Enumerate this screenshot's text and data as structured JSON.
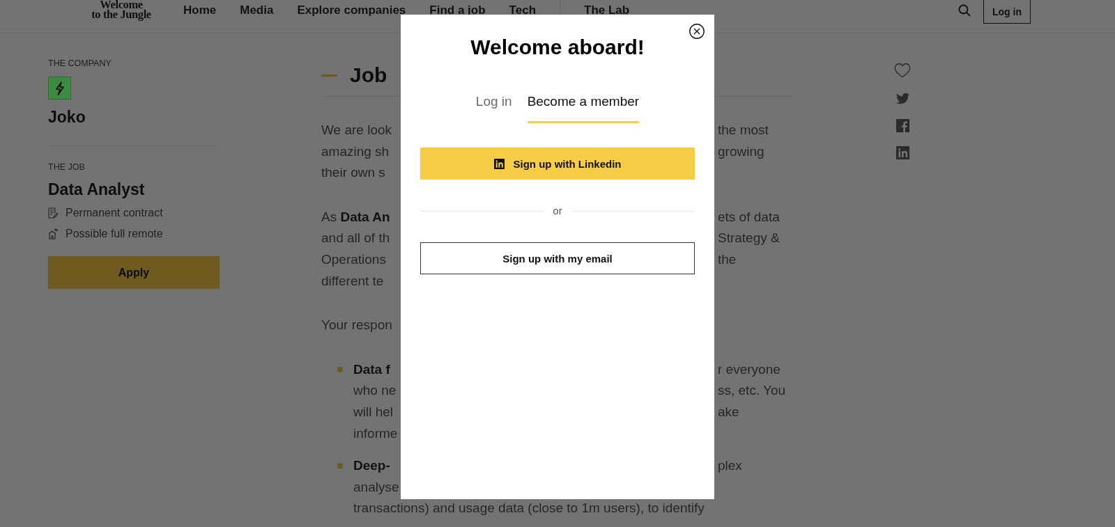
{
  "header": {
    "logo": [
      "Welcome",
      "to the Jungle"
    ],
    "nav_primary": [
      "Home",
      "Media",
      "Explore companies",
      "Find a job",
      "Tech"
    ],
    "nav_secondary": [
      "The Lab"
    ],
    "login_button": "Log in"
  },
  "sidebar": {
    "company_label": "THE COMPANY",
    "company_name": "Joko",
    "job_label": "THE JOB",
    "job_title": "Data Analyst",
    "details": [
      {
        "kind": "contract",
        "text": "Permanent contract"
      },
      {
        "kind": "remote",
        "text": "Possible full remote"
      }
    ],
    "apply_button": "Apply"
  },
  "article": {
    "heading": "Job",
    "blocks": [
      {
        "kind": "paragraph",
        "lines": [
          {
            "left": "We are look",
            "right": "the most"
          },
          {
            "left": "amazing sh",
            "right": "growing"
          },
          {
            "left": "their own s"
          }
        ]
      },
      {
        "kind": "paragraph",
        "lines": [
          {
            "left": "As **Data An**",
            "right": "ets of data"
          },
          {
            "left": "and all of th",
            "right": "Strategy &"
          },
          {
            "left": "Operations",
            "right": "the"
          },
          {
            "left": "different te"
          }
        ]
      },
      {
        "kind": "paragraph",
        "lines": [
          {
            "left": "Your respon"
          }
        ]
      },
      {
        "kind": "bullet",
        "lines": [
          {
            "left": "**Data f**",
            "right": "r everyone"
          },
          {
            "left": "who ne",
            "right": "ss, etc. You"
          },
          {
            "left": "will hel",
            "right": "ake"
          },
          {
            "left": "informe"
          }
        ]
      },
      {
        "kind": "bullet",
        "lines": [
          {
            "left": "**Deep-**",
            "right": "plex"
          },
          {
            "left": "analyse"
          },
          {
            "text": "transactions) and usage data (close to 1m users), to identify"
          }
        ]
      }
    ]
  },
  "modal": {
    "title": "Welcome aboard!",
    "tabs": [
      {
        "label": "Log in",
        "selected": false
      },
      {
        "label": "Become a member",
        "selected": true
      }
    ],
    "linkedin_button": "Sign up with Linkedin",
    "divider_text": "or",
    "email_button": "Sign up with my email"
  }
}
